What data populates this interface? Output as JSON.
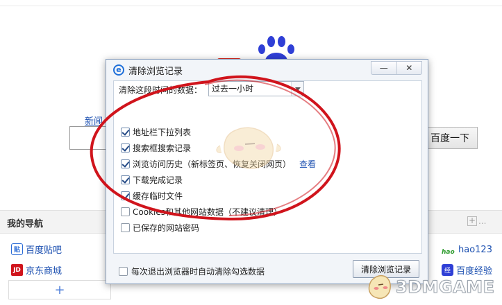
{
  "background_page": {
    "news_link": "新闻",
    "search_button": "百度一下",
    "nav_title": "我的导航",
    "nav_more": "...",
    "add_label": "+",
    "sites": [
      {
        "label": "百度贴吧",
        "icon": "tieba-icon"
      },
      {
        "label": "京东商城",
        "icon": "jd-icon"
      },
      {
        "label": "hao123",
        "icon": "hao123-icon"
      },
      {
        "label": "百度经验",
        "icon": "jingyan-icon"
      }
    ],
    "icon_glyphs": {
      "tieba": "贴",
      "jd": "JD",
      "hao": "hao",
      "jingyan": "经"
    }
  },
  "dialog": {
    "title": "清除浏览记录",
    "minimize": "—",
    "close": "✕",
    "range_label": "清除这段时间的数据：",
    "range_value": "过去一小时",
    "options": [
      {
        "label": "地址栏下拉列表",
        "checked": true
      },
      {
        "label": "搜索框搜索记录",
        "checked": true
      },
      {
        "label": "浏览访问历史（新标签页、恢复关闭网页）",
        "checked": true,
        "link": "查看"
      },
      {
        "label": "下载完成记录",
        "checked": true
      },
      {
        "label": "缓存临时文件",
        "checked": true
      },
      {
        "label": "Cookies和其他网站数据（不建议清理）",
        "checked": false
      },
      {
        "label": "已保存的网站密码",
        "checked": false
      }
    ],
    "auto_clear_label": "每次退出浏览器时自动清除勾选数据",
    "auto_clear_checked": false,
    "clear_button": "清除浏览记录"
  },
  "watermark": {
    "text": "3DMGAME"
  },
  "colors": {
    "annotation_red": "#d0141c",
    "link_blue": "#1b4fb0",
    "baidu_blue": "#2f3fd6",
    "dialog_bg": "#f2f5f9"
  }
}
